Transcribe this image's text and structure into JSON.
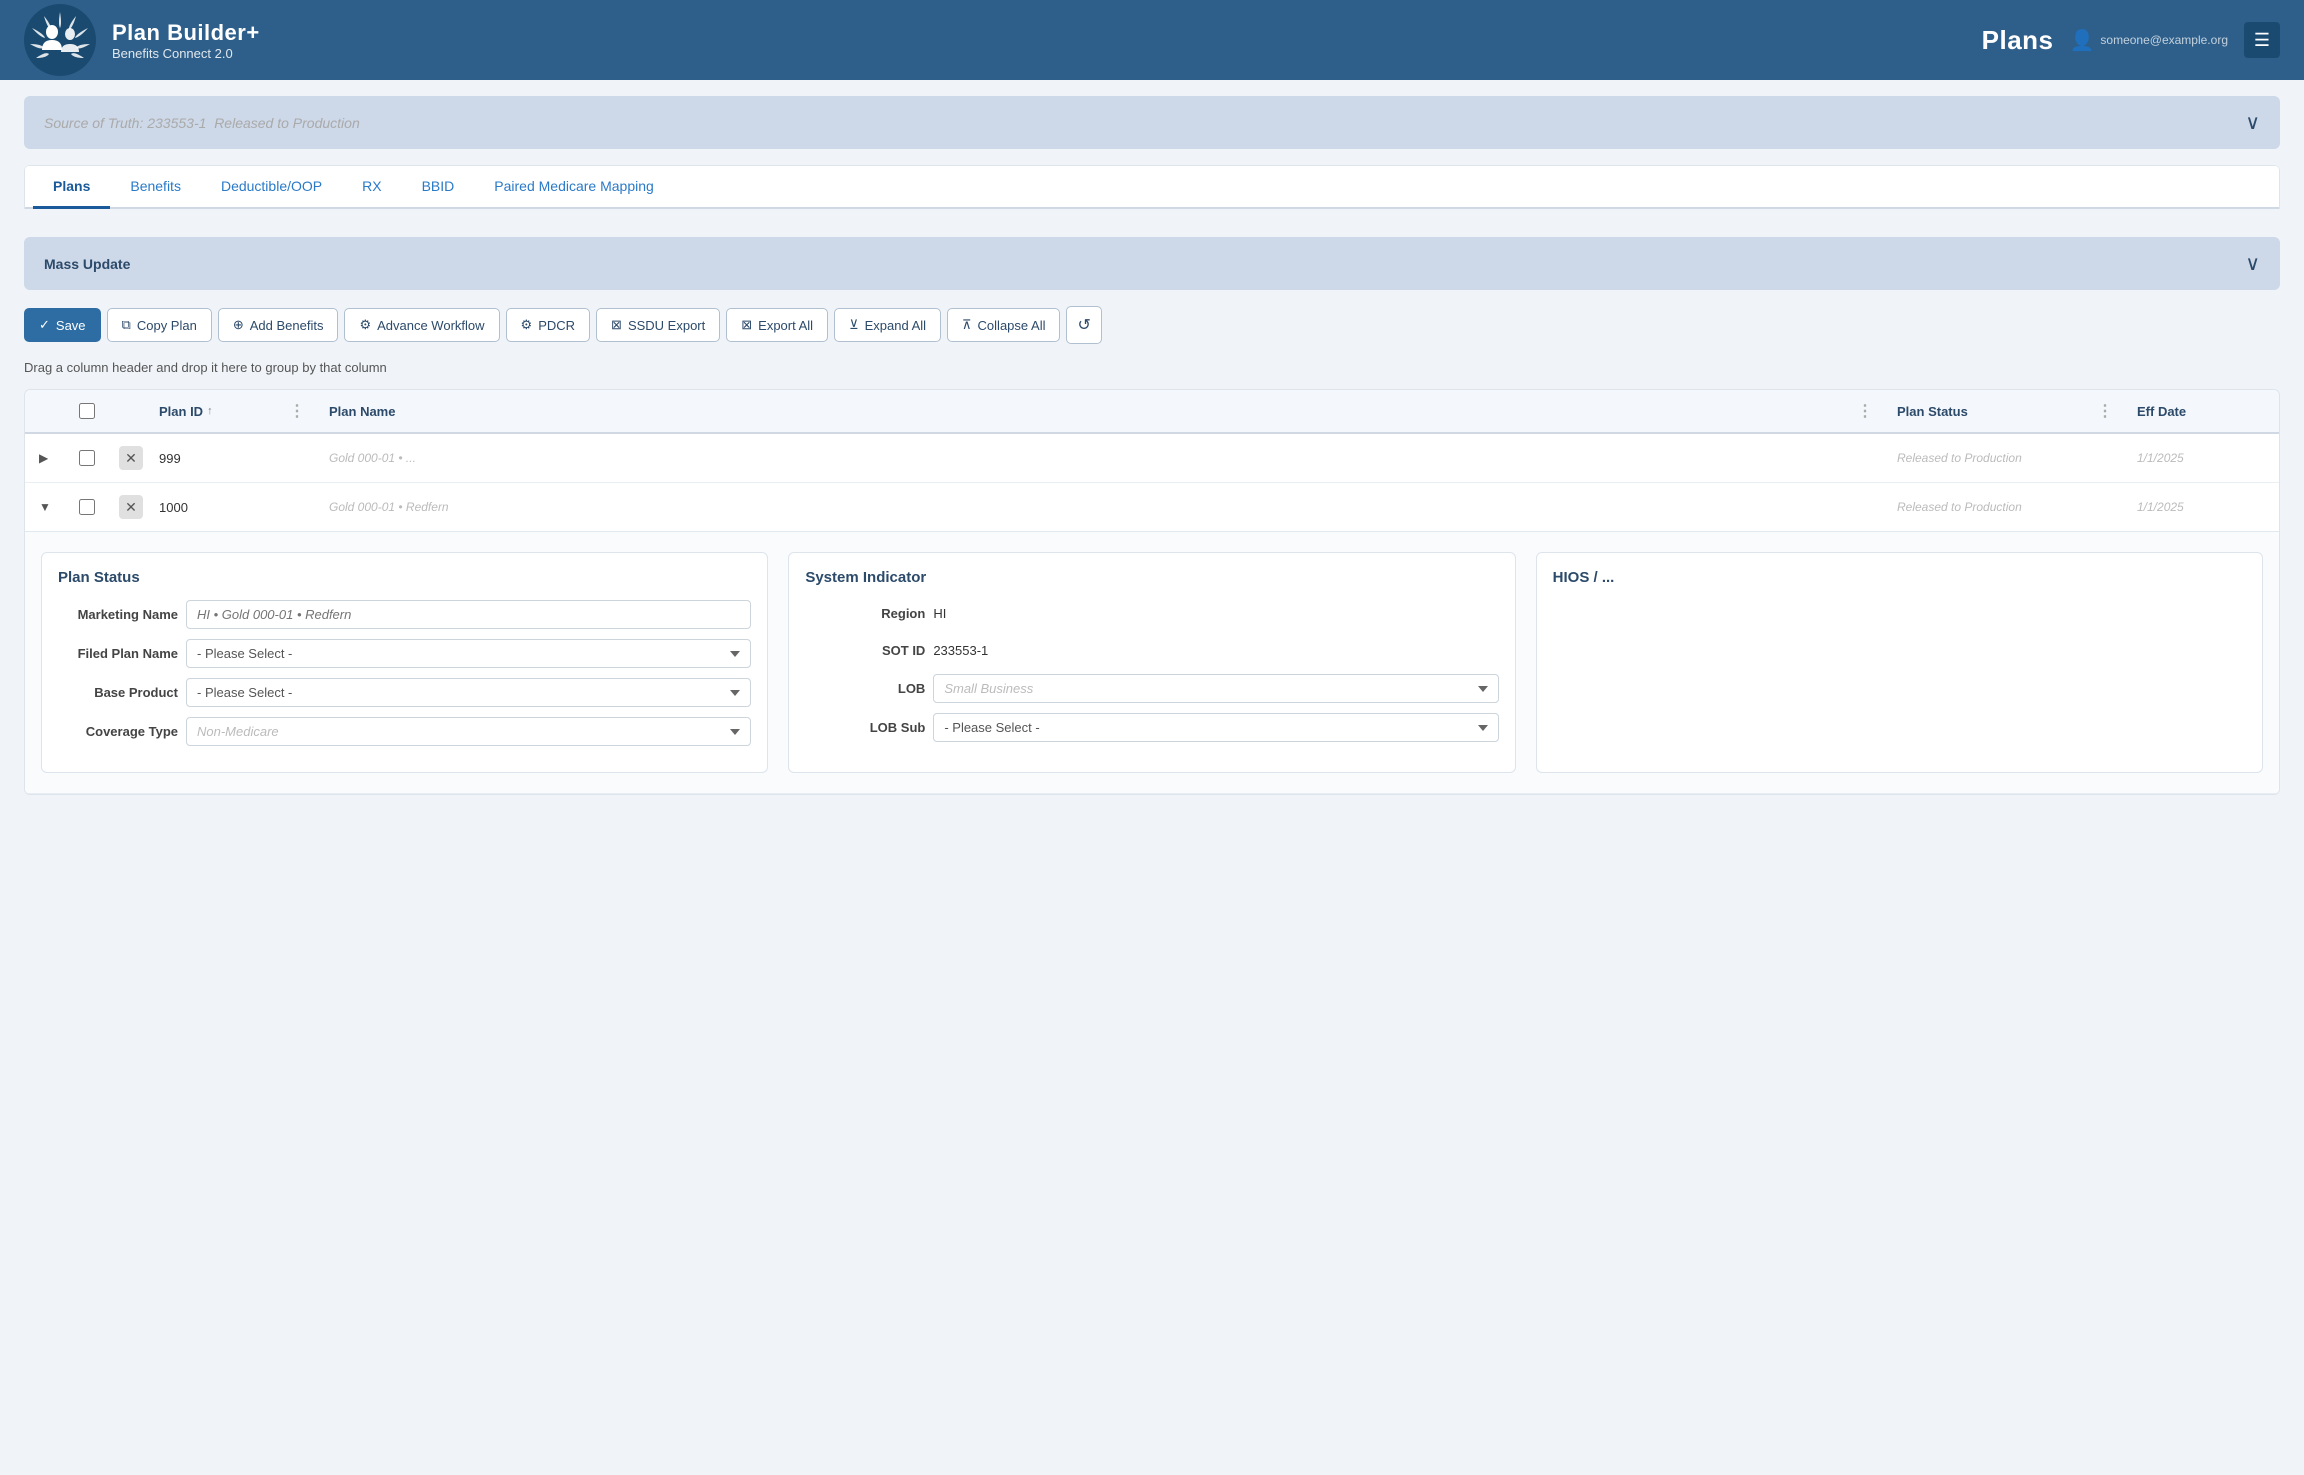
{
  "header": {
    "app_name": "Plan Builder+",
    "app_subtitle": "Benefits Connect 2.0",
    "plans_label": "Plans",
    "user_email": "someone@example.org",
    "menu_icon": "☰",
    "logo_alt": "Benefits Connect Logo"
  },
  "source_bar": {
    "label": "Source of Truth: 233553-1",
    "status_blurred": "Released to Production",
    "chevron": "∨"
  },
  "tabs": [
    {
      "id": "plans",
      "label": "Plans",
      "active": true
    },
    {
      "id": "benefits",
      "label": "Benefits",
      "active": false
    },
    {
      "id": "deductible",
      "label": "Deductible/OOP",
      "active": false
    },
    {
      "id": "rx",
      "label": "RX",
      "active": false
    },
    {
      "id": "bbid",
      "label": "BBID",
      "active": false
    },
    {
      "id": "paired",
      "label": "Paired Medicare Mapping",
      "active": false
    }
  ],
  "mass_update": {
    "label": "Mass Update",
    "chevron": "∨"
  },
  "toolbar": {
    "save": "Save",
    "copy_plan": "Copy Plan",
    "add_benefits": "Add Benefits",
    "advance_workflow": "Advance Workflow",
    "pdcr": "PDCR",
    "ssdu_export": "SSDU Export",
    "export_all": "Export All",
    "expand_all": "Expand All",
    "collapse_all": "Collapse All",
    "refresh": "↺"
  },
  "drag_hint": "Drag a column header and drop it here to group by that column",
  "table": {
    "columns": [
      {
        "id": "expand",
        "label": ""
      },
      {
        "id": "checkbox",
        "label": ""
      },
      {
        "id": "delete",
        "label": ""
      },
      {
        "id": "plan_id",
        "label": "Plan ID"
      },
      {
        "id": "plan_id_menu",
        "label": ""
      },
      {
        "id": "plan_name",
        "label": "Plan Name"
      },
      {
        "id": "plan_name_menu",
        "label": ""
      },
      {
        "id": "plan_status",
        "label": "Plan Status"
      },
      {
        "id": "plan_status_menu",
        "label": ""
      },
      {
        "id": "eff_date",
        "label": "Eff Date"
      }
    ],
    "rows": [
      {
        "id": "row-999",
        "expanded": false,
        "plan_id": "999",
        "plan_name_blurred": "Gold 000-01 • ...",
        "plan_status_blurred": "Released to Production",
        "eff_date_blurred": "1/1/2025"
      },
      {
        "id": "row-1000",
        "expanded": true,
        "plan_id": "1000",
        "plan_name_blurred": "Gold 000-01 • Redfern",
        "plan_status_blurred": "Released to Production",
        "eff_date_blurred": "1/1/2025"
      }
    ]
  },
  "detail": {
    "plan_status_card": {
      "title": "Plan Status",
      "fields": [
        {
          "label": "Marketing Name",
          "type": "input",
          "value_blurred": "HI • Gold 000-01 • Redfern",
          "placeholder": ""
        },
        {
          "label": "Filed Plan Name",
          "type": "select",
          "value": "- Please Select -"
        },
        {
          "label": "Base Product",
          "type": "select",
          "value": "- Please Select -"
        },
        {
          "label": "Coverage Type",
          "type": "select",
          "value_blurred": "Non-Medicare"
        }
      ]
    },
    "system_indicator_card": {
      "title": "System Indicator",
      "fields": [
        {
          "label": "Region",
          "type": "value",
          "value": "HI"
        },
        {
          "label": "SOT ID",
          "type": "value",
          "value": "233553-1"
        },
        {
          "label": "LOB",
          "type": "select",
          "value_blurred": "Small Business"
        },
        {
          "label": "LOB Sub",
          "type": "select",
          "value": "- Please Select -"
        }
      ]
    },
    "hios_card": {
      "title": "HIOS / ...",
      "fields": []
    }
  }
}
